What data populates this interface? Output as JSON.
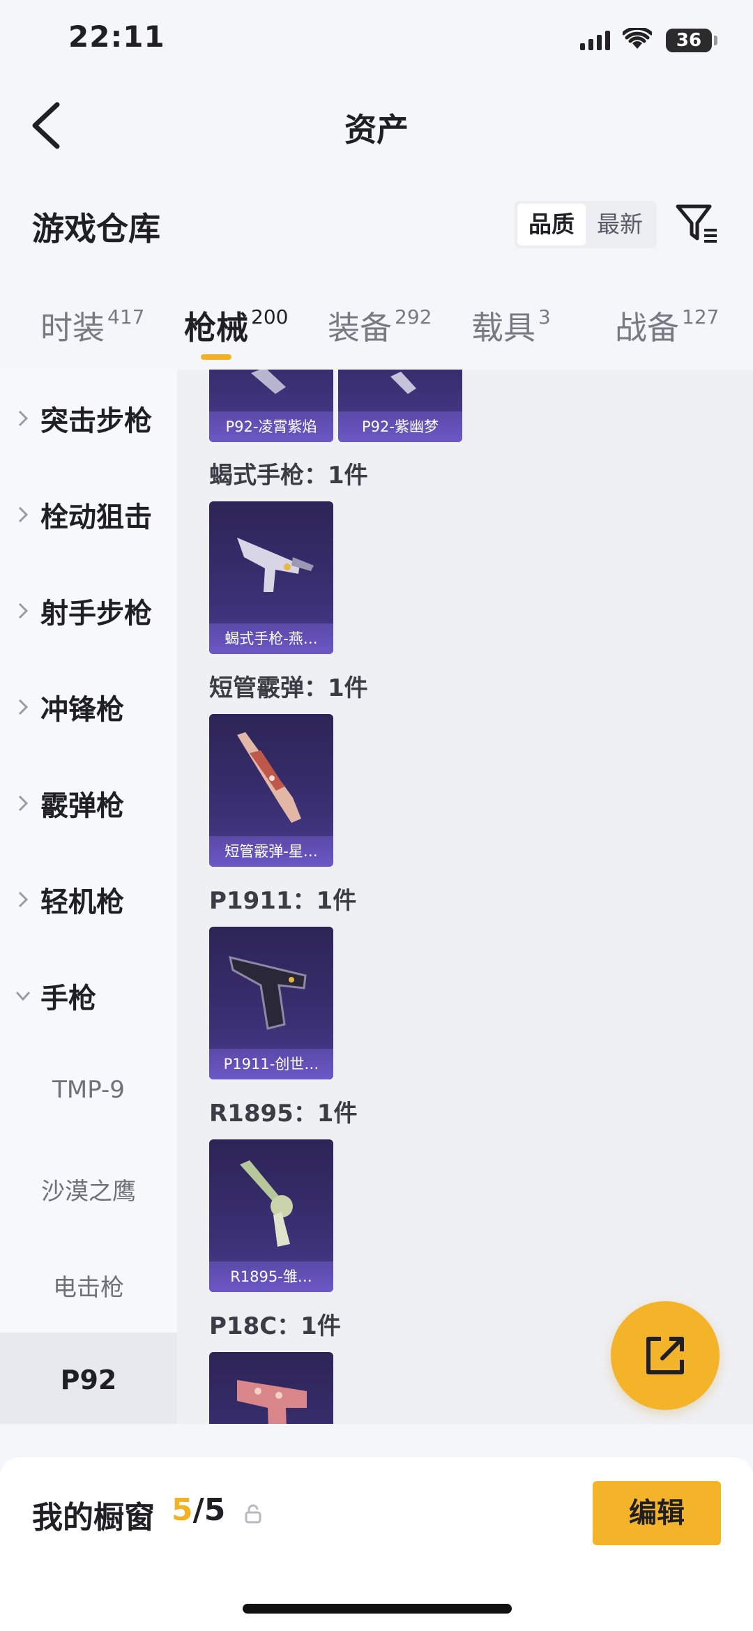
{
  "status_bar": {
    "time": "22:11",
    "battery": "36"
  },
  "nav": {
    "title": "资产"
  },
  "header": {
    "section_title": "游戏仓库",
    "sort_active": "品质",
    "sort_inactive": "最新"
  },
  "tabs": [
    {
      "label": "时装",
      "count": "417"
    },
    {
      "label": "枪械",
      "count": "200"
    },
    {
      "label": "装备",
      "count": "292"
    },
    {
      "label": "载具",
      "count": "3"
    },
    {
      "label": "战备",
      "count": "127"
    }
  ],
  "sidebar": {
    "categories": [
      "突击步枪",
      "栓动狙击",
      "射手步枪",
      "冲锋枪",
      "霰弹枪",
      "轻机枪",
      "手枪"
    ],
    "subcategories": [
      "TMP-9",
      "沙漠之鹰",
      "电击枪",
      "P92"
    ]
  },
  "content": {
    "top_cards": [
      "P92-凌霄紫焰",
      "P92-紫幽梦"
    ],
    "groups": [
      {
        "heading": "蝎式手枪：1件",
        "card": "蝎式手枪-燕…"
      },
      {
        "heading": "短管霰弹：1件",
        "card": "短管霰弹-星…"
      },
      {
        "heading": "P1911：1件",
        "card": "P1911-创世…"
      },
      {
        "heading": "R1895：1件",
        "card": "R1895-雏…"
      },
      {
        "heading": "P18C：1件",
        "card": ""
      }
    ]
  },
  "bottom": {
    "showcase_label": "我的橱窗",
    "count_current": "5",
    "count_sep": "/",
    "count_total": "5",
    "edit_label": "编辑"
  },
  "colors": {
    "accent": "#f3b224",
    "card_bg": "#3a2f72",
    "card_label_bg": "#6b58c6"
  }
}
